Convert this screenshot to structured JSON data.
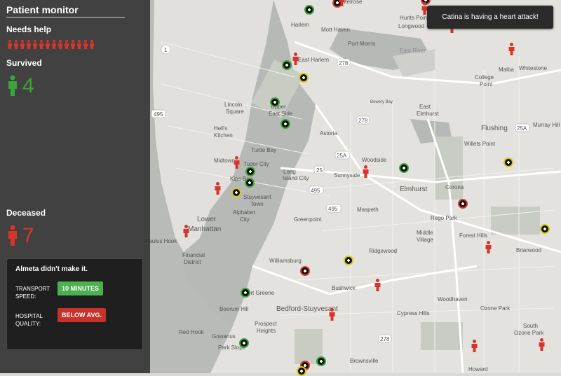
{
  "app": {
    "title": "Patient monitor"
  },
  "sidebar": {
    "needs_help_label": "Needs help",
    "waiting_count": 14,
    "survived_label": "Survived",
    "survived_count": "4",
    "deceased_label": "Deceased",
    "deceased_count": "7",
    "icons": {
      "survived": "person-icon",
      "deceased": "person-icon",
      "waiting": "person-icon"
    },
    "colors": {
      "survived": "#3aa53a",
      "deceased": "#d9342b",
      "waiting": "#d9342b"
    }
  },
  "outcome": {
    "message": "Almeta didn't make it.",
    "transport_label": "TRANSPORT SPEED:",
    "transport_value": "10 MINUTES",
    "quality_label": "HOSPITAL QUALITY:",
    "quality_value": "BELOW AVG."
  },
  "toast": {
    "message": "Catina is having a heart attack!"
  },
  "map": {
    "labels": [
      "Harlem",
      "Mott Haven",
      "Port Morris",
      "Hunts Point",
      "Melrose",
      "Longwood",
      "East Harlem",
      "Lincoln Square",
      "Upper East Side",
      "Hell's Kitchen",
      "Midtown",
      "Turtle Bay",
      "Tudor City",
      "Kips Bay",
      "Stuyvesant Town",
      "Alphabet City",
      "Lower Manhattan",
      "Financial District",
      "Astoria",
      "Long Island City",
      "Sunnyside",
      "Woodside",
      "Maspeth",
      "Greenpoint",
      "Williamsburg",
      "Bushwick",
      "Ridgewood",
      "Elmhurst",
      "East Elmhurst",
      "Corona",
      "Rego Park",
      "Middle Village",
      "Forest Hills",
      "Flushing",
      "Whitestone",
      "College Point",
      "Malba",
      "Willets Point",
      "Murray Hill",
      "Briarwood",
      "Woodhaven",
      "Cypress Hills",
      "Ozone Park",
      "South Ozone Park",
      "Howard",
      "Brownsville",
      "Bedford-Stuyvesant",
      "Fort Greene",
      "Boerum Hill",
      "Red Hook",
      "Prospect Heights",
      "Gowanus",
      "Park Slope",
      "Paulus Hook",
      "Riker's Island",
      "Bowery Bay",
      "Flushing Meadows Corona Park",
      "East River"
    ],
    "road_shields": [
      "495",
      "278",
      "278",
      "278",
      "278",
      "25A",
      "25A",
      "25",
      "495",
      "495",
      "1"
    ],
    "markers": [
      "plus-icon",
      "plus-icon",
      "plus-icon",
      "plus-icon",
      "plus-icon",
      "plus-icon",
      "plus-icon",
      "plus-icon",
      "plus-icon",
      "plus-icon",
      "plus-icon",
      "plus-icon",
      "plus-icon",
      "plus-icon",
      "plus-icon",
      "plus-icon",
      "plus-icon",
      "plus-icon",
      "plus-icon",
      "plus-icon",
      "plus-icon"
    ],
    "patients": [
      "person-icon",
      "person-icon",
      "person-icon",
      "person-icon",
      "person-icon",
      "person-icon",
      "person-icon",
      "person-icon",
      "person-icon",
      "person-icon",
      "person-icon",
      "person-icon",
      "person-icon",
      "person-icon"
    ]
  }
}
